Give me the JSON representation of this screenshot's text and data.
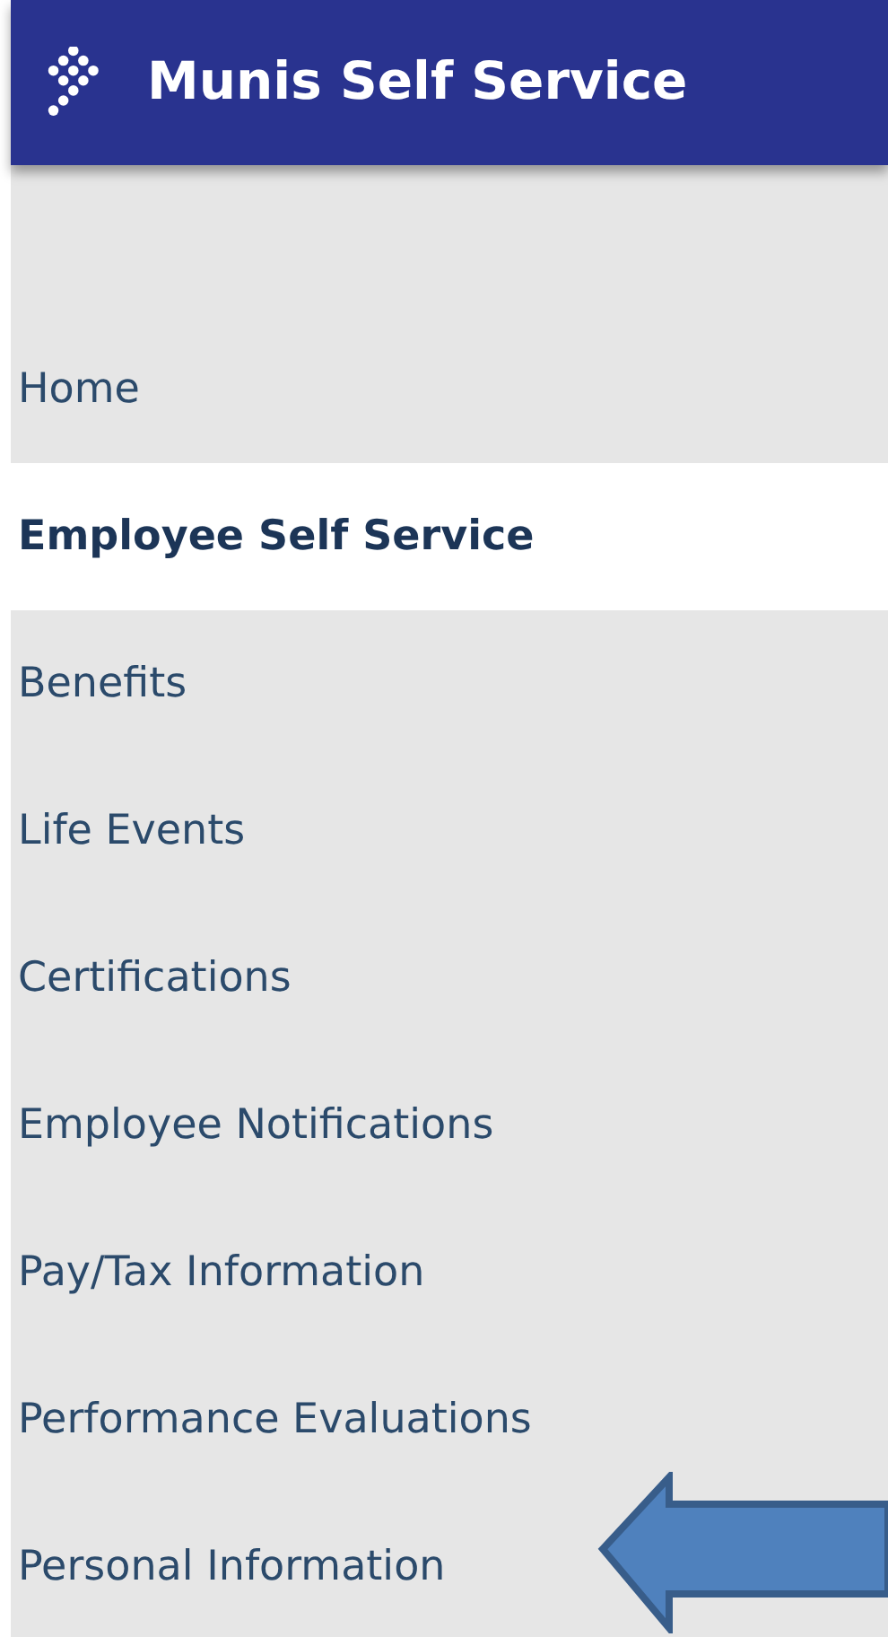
{
  "header": {
    "title": "Munis Self Service"
  },
  "nav": {
    "items": [
      {
        "label": "Home",
        "selected": false
      },
      {
        "label": "Employee Self Service",
        "selected": true
      },
      {
        "label": "Benefits",
        "selected": false
      },
      {
        "label": "Life Events",
        "selected": false
      },
      {
        "label": "Certifications",
        "selected": false
      },
      {
        "label": "Employee Notifications",
        "selected": false
      },
      {
        "label": "Pay/Tax Information",
        "selected": false
      },
      {
        "label": "Performance Evaluations",
        "selected": false
      },
      {
        "label": "Personal Information",
        "selected": false
      }
    ]
  }
}
